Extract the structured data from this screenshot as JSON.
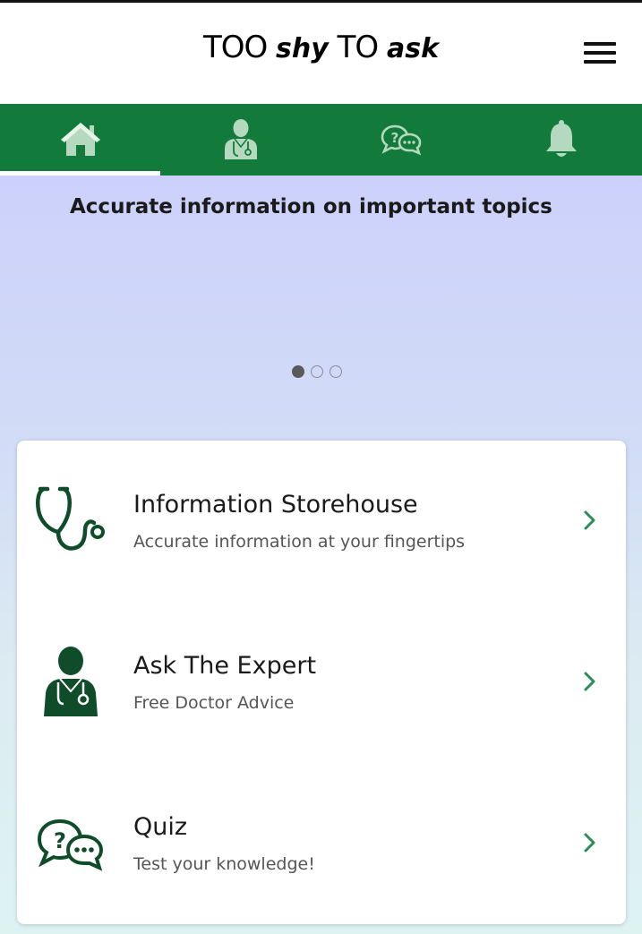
{
  "header": {
    "logo_part1": "TOO ",
    "logo_part2": "shy",
    "logo_part3": " TO ",
    "logo_part4": "ask"
  },
  "nav": {
    "tabs": [
      {
        "icon": "home-icon",
        "active": true
      },
      {
        "icon": "doctor-icon",
        "active": false
      },
      {
        "icon": "quiz-chat-icon",
        "active": false
      },
      {
        "icon": "bell-icon",
        "active": false
      }
    ]
  },
  "banner": {
    "title": "Accurate information on important topics",
    "slides": 3,
    "active_slide": 1
  },
  "menu": {
    "items": [
      {
        "title": "Information Storehouse",
        "subtitle": "Accurate information at your fingertips",
        "icon": "stethoscope-icon"
      },
      {
        "title": "Ask The Expert",
        "subtitle": "Free Doctor Advice",
        "icon": "doctor-icon"
      },
      {
        "title": "Quiz",
        "subtitle": "Test your knowledge!",
        "icon": "quiz-chat-icon"
      }
    ]
  },
  "colors": {
    "nav_green": "#127a3a",
    "icon_dark_green": "#0f4d2a",
    "chevron_green": "#2a8f55",
    "nav_icon": "#b5d9bf"
  }
}
